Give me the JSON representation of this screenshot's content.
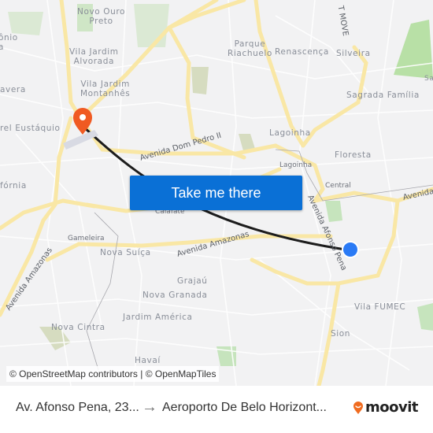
{
  "map": {
    "neighborhoods": [
      {
        "name": "Novo Ouro\nPreto"
      },
      {
        "name": "ônio\na"
      },
      {
        "name": "Vila Jardim\nAlvorada"
      },
      {
        "name": "Vila Jardim\nMontanhês"
      },
      {
        "name": "avera"
      },
      {
        "name": "rel Eustáquio"
      },
      {
        "name": "Parque\nRiachuelo"
      },
      {
        "name": "Renascença"
      },
      {
        "name": "Silveira"
      },
      {
        "name": "Sagrada Família"
      },
      {
        "name": "Sa"
      },
      {
        "name": "Lagoinha"
      },
      {
        "name": "Floresta"
      },
      {
        "name": "fórnia"
      },
      {
        "name": "Nova Suíça"
      },
      {
        "name": "Grajaú"
      },
      {
        "name": "Nova Granada"
      },
      {
        "name": "Jardim América"
      },
      {
        "name": "Nova Cintra"
      },
      {
        "name": "Havaí"
      },
      {
        "name": "Vila FUMEC"
      },
      {
        "name": "Sion"
      }
    ],
    "stations": [
      {
        "name": "Lagoinha"
      },
      {
        "name": "Central"
      },
      {
        "name": "Calafate"
      },
      {
        "name": "Gameleira"
      }
    ],
    "roads": [
      {
        "name": "Avenida Dom Pedro II"
      },
      {
        "name": "Avenida Amazonas"
      },
      {
        "name": "Avenida Amazonas"
      },
      {
        "name": "Avenida Afonso Pena"
      },
      {
        "name": "T MOVE"
      },
      {
        "name": "Avenida"
      }
    ],
    "origin_marker": {
      "label": "origin",
      "color": "#2a7af5"
    },
    "destination_marker": {
      "label": "destination",
      "color": "#f05a22"
    },
    "route_color": "#1c1c1c"
  },
  "cta": {
    "label": "Take me there",
    "color": "#0a70d6"
  },
  "attribution": "© OpenStreetMap contributors | © OpenMapTiles",
  "footer": {
    "from": "Av. Afonso Pena, 23...",
    "arrow": "→",
    "to": "Aeroporto De Belo Horizont...",
    "brand": "moovit",
    "brand_color": "#f06b1f"
  }
}
